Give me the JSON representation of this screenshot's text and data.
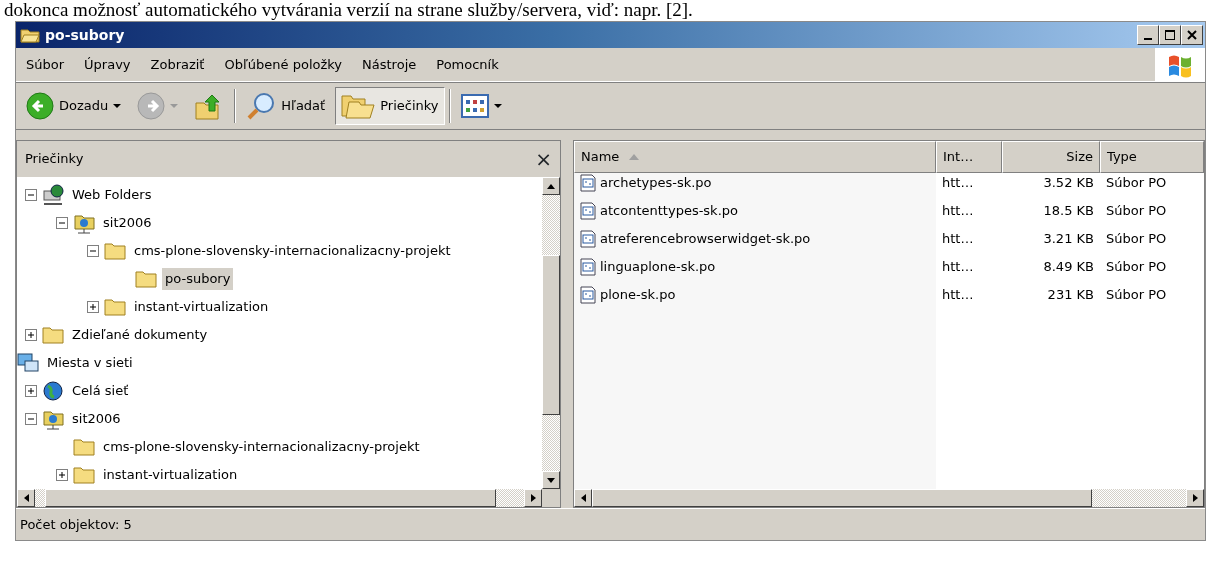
{
  "document_text": "dokonca možnosť automatického vytvárania verzií na strane služby/servera, viď: napr. [2].",
  "window": {
    "title": "po-subory"
  },
  "menu": [
    "Súbor",
    "Úpravy",
    "Zobraziť",
    "Obľúbené položky",
    "Nástroje",
    "Pomocník"
  ],
  "toolbar": [
    {
      "kind": "back",
      "label": "Dozadu",
      "disabled": false
    },
    {
      "kind": "forward",
      "disabled": true
    },
    {
      "kind": "up",
      "disabled": false
    },
    {
      "kind": "search",
      "label": "Hľadať",
      "selected": false
    },
    {
      "kind": "folders",
      "label": "Priečinky",
      "selected": true
    },
    {
      "kind": "views",
      "disabled": false
    }
  ],
  "folders_pane": {
    "title": "Priečinky",
    "close": "×",
    "nodes": [
      {
        "children": [
          {
            "label": "Web Folders",
            "kind": "network",
            "expanded": true,
            "selected": false,
            "children": [
              {
                "label": "sit2006",
                "kind": "server",
                "expanded": true,
                "selected": false,
                "children": [
                  {
                    "label": "cms-plone-slovensky-internacionalizacny-projekt",
                    "kind": "folder",
                    "expanded": true,
                    "selected": false,
                    "children": [
                      {
                        "label": "po-subory",
                        "kind": "folder",
                        "selected": true
                      }
                    ]
                  },
                  {
                    "label": "instant-virtualization",
                    "kind": "folder",
                    "expanded": false,
                    "selected": false
                  }
                ]
              }
            ]
          },
          {
            "label": "Zdieľané dokumenty",
            "kind": "folder",
            "expanded": false,
            "selected": false
          }
        ]
      },
      {
        "label": "Miesta v sieti",
        "kind": "computers",
        "selected": false,
        "children": [
          {
            "label": "Celá sieť",
            "kind": "globe",
            "expanded": false,
            "selected": false
          },
          {
            "label": "sit2006",
            "kind": "server",
            "expanded": true,
            "selected": false,
            "children": [
              {
                "label": "cms-plone-slovensky-internacionalizacny-projekt",
                "kind": "folder",
                "selected": false
              },
              {
                "label": "instant-virtualization",
                "kind": "folder",
                "expanded": false,
                "selected": false
              }
            ]
          }
        ]
      }
    ]
  },
  "file_list": {
    "columns": [
      {
        "label": "Name",
        "sorted": true
      },
      {
        "label": "Int…",
        "sorted": false
      },
      {
        "label": "Size",
        "sorted": false
      },
      {
        "label": "Type",
        "sorted": false
      }
    ],
    "rows": [
      {
        "name": "archetypes-sk.po",
        "column_2": "htt…",
        "size": "3.52 KB",
        "type": "Súbor PO"
      },
      {
        "name": "atcontenttypes-sk.po",
        "column_2": "htt…",
        "size": "18.5 KB",
        "type": "Súbor PO"
      },
      {
        "name": "atreferencebrowserwidget-sk.po",
        "column_2": "htt…",
        "size": "3.21 KB",
        "type": "Súbor PO"
      },
      {
        "name": "linguaplone-sk.po",
        "column_2": "htt…",
        "size": "8.49 KB",
        "type": "Súbor PO"
      },
      {
        "name": "plone-sk.po",
        "column_2": "htt…",
        "size": "231 KB",
        "type": "Súbor PO"
      }
    ]
  },
  "status_bar": "Počet objektov: 5"
}
